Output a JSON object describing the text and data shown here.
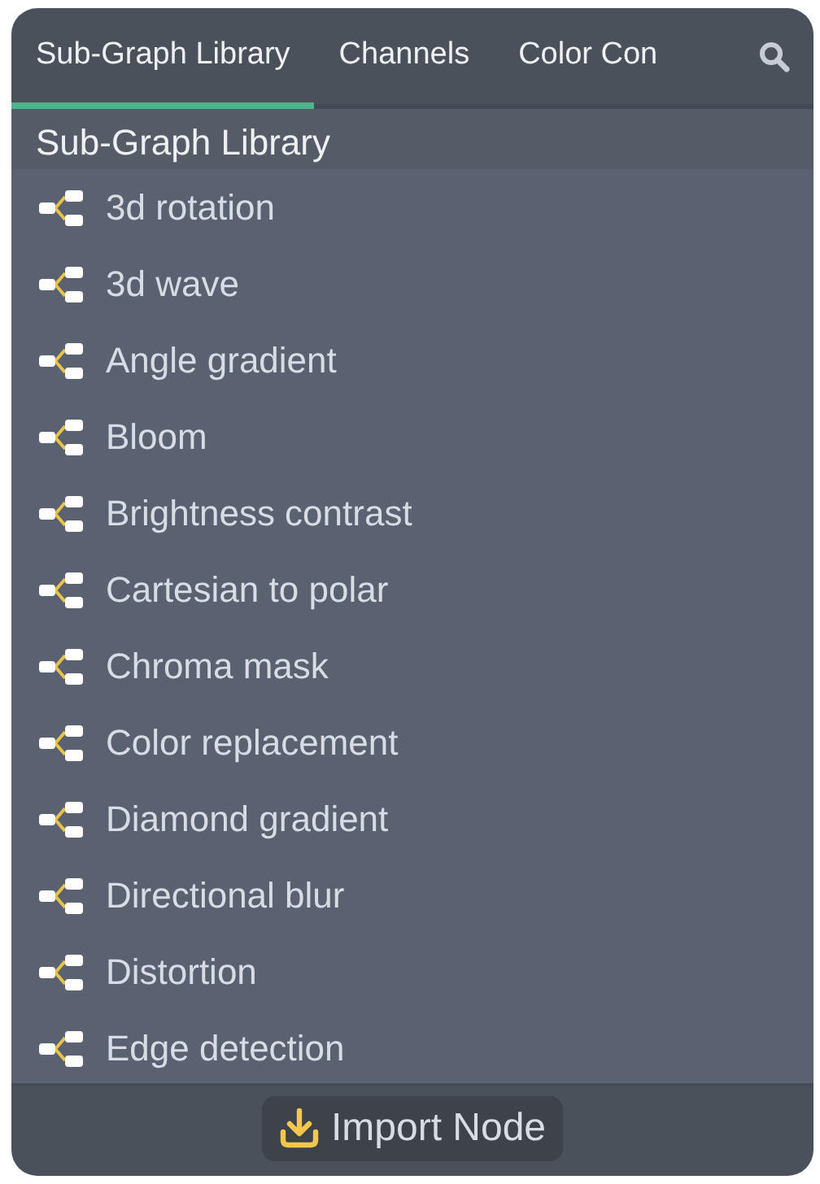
{
  "tabs": [
    {
      "label": "Sub-Graph Library",
      "selected": true
    },
    {
      "label": "Channels",
      "selected": false
    },
    {
      "label": "Color Con",
      "selected": false
    }
  ],
  "section": {
    "title": "Sub-Graph Library"
  },
  "items": [
    {
      "label": "3d rotation"
    },
    {
      "label": "3d wave"
    },
    {
      "label": "Angle gradient"
    },
    {
      "label": "Bloom"
    },
    {
      "label": "Brightness contrast"
    },
    {
      "label": "Cartesian to polar"
    },
    {
      "label": "Chroma mask"
    },
    {
      "label": "Color replacement"
    },
    {
      "label": "Diamond gradient"
    },
    {
      "label": "Directional blur"
    },
    {
      "label": "Distortion"
    },
    {
      "label": "Edge detection"
    }
  ],
  "footer": {
    "button": "Import Node"
  }
}
